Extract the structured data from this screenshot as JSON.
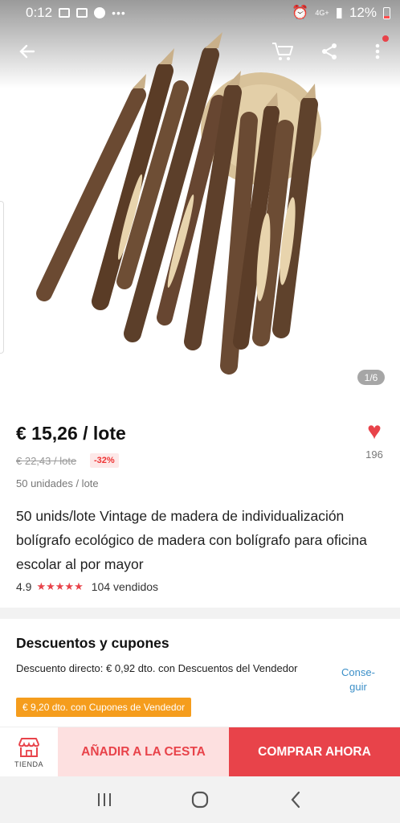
{
  "status_bar": {
    "time": "0:12",
    "battery": "12%",
    "network": "4G+"
  },
  "gallery": {
    "counter": "1/6"
  },
  "product": {
    "price": "€ 15,26 / lote",
    "original_price": "€ 22,43 / lote",
    "discount": "-32%",
    "units": "50 unidades / lote",
    "title": "50 unids/lote Vintage de madera de individualización bolígrafo ecológico de madera con bolígrafo para oficina escolar al por mayor",
    "rating": "4.9",
    "stars": "★★★★★",
    "sold": "104 vendidos",
    "wishlist_count": "196"
  },
  "discounts": {
    "title": "Descuentos y cupones",
    "direct_discount": "Descuento directo: € 0,92 dto. con Descuentos del Vendedor",
    "get_link": "Conse-guir",
    "coupon": "€ 9,20 dto. con Cupones de Vendedor"
  },
  "actions": {
    "store_label": "TIENDA",
    "add_to_cart": "AÑADIR A LA CESTA",
    "buy_now": "COMPRAR AHORA"
  },
  "colors": {
    "accent": "#e8434a",
    "coupon": "#f59d1d",
    "link": "#3b8fc8"
  },
  "icons": [
    "back-arrow-icon",
    "cart-icon",
    "share-icon",
    "more-icon",
    "heart-icon",
    "store-icon",
    "recents-icon",
    "home-icon",
    "system-back-icon"
  ]
}
